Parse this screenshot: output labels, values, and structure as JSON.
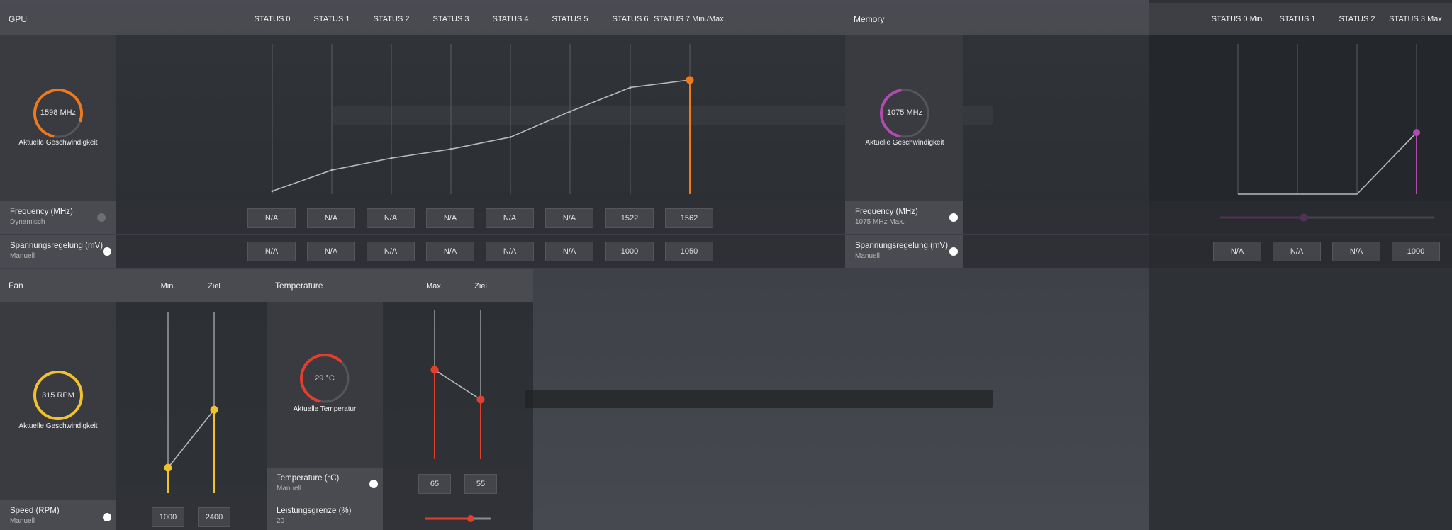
{
  "gpu": {
    "title": "GPU",
    "status_headers": [
      "STATUS 0",
      "STATUS 1",
      "STATUS 2",
      "STATUS 3",
      "STATUS 4",
      "STATUS 5",
      "STATUS 6",
      "STATUS 7 Min./Max."
    ],
    "gauge_value": "1598 MHz",
    "gauge_label": "Aktuelle Geschwindigkeit",
    "gauge_fraction": 0.78,
    "accent": "#f07a1a",
    "frequency_curve": [
      0.02,
      0.16,
      0.24,
      0.3,
      0.38,
      0.55,
      0.71,
      0.76
    ],
    "frequency_row": {
      "label": "Frequency (MHz)",
      "mode": "Dynamisch",
      "enabled": false,
      "values": [
        "N/A",
        "N/A",
        "N/A",
        "N/A",
        "N/A",
        "N/A",
        "1522",
        "1562"
      ]
    },
    "voltage_row": {
      "label": "Spannungsregelung (mV)",
      "mode": "Manuell",
      "enabled": true,
      "values": [
        "N/A",
        "N/A",
        "N/A",
        "N/A",
        "N/A",
        "N/A",
        "1000",
        "1050"
      ]
    }
  },
  "memory": {
    "title": "Memory",
    "status_headers": [
      "STATUS 0 Min.",
      "STATUS 1",
      "STATUS 2",
      "STATUS 3 Max."
    ],
    "gauge_value": "1075 MHz",
    "gauge_label": "Aktuelle Geschwindigkeit",
    "gauge_fraction": 0.45,
    "accent": "#b04bb0",
    "frequency_curve": [
      0.0,
      0.0,
      0.0,
      0.41
    ],
    "slider_fraction": 0.39,
    "frequency_row": {
      "label": "Frequency (MHz)",
      "mode": "1075 MHz Max.",
      "enabled": true
    },
    "voltage_row": {
      "label": "Spannungsregelung (mV)",
      "mode": "Manuell",
      "enabled": true,
      "values": [
        "N/A",
        "N/A",
        "N/A",
        "1000"
      ]
    }
  },
  "fan": {
    "title": "Fan",
    "col_headers": [
      "Min.",
      "Ziel"
    ],
    "gauge_value": "315 RPM",
    "gauge_label": "Aktuelle Geschwindigkeit",
    "gauge_fraction": 1.0,
    "accent": "#f2c12e",
    "slider_fractions": [
      0.14,
      0.46
    ],
    "speed_row": {
      "label": "Speed (RPM)",
      "mode": "Manuell",
      "enabled": true,
      "values": [
        "1000",
        "2400"
      ]
    }
  },
  "temperature": {
    "title": "Temperature",
    "col_headers": [
      "Max.",
      "Ziel"
    ],
    "gauge_value": "29 °C",
    "gauge_label": "Aktuelle Temperatur",
    "gauge_fraction": 0.6,
    "accent": "#e2402e",
    "slider_fractions": [
      0.6,
      0.4
    ],
    "temp_row": {
      "label": "Temperature (°C)",
      "mode": "Manuell",
      "enabled": true,
      "values": [
        "65",
        "55"
      ]
    },
    "power_row": {
      "label": "Leistungsgrenze (%)",
      "mode": "20",
      "slider_fraction": 0.7
    }
  }
}
